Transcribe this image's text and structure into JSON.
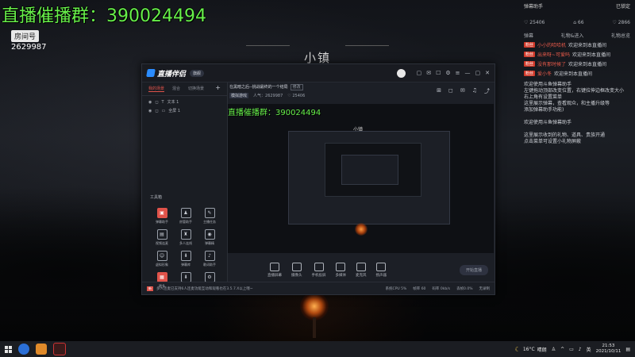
{
  "overlay": {
    "group_label": "直播催播群：",
    "group_number": "390024494",
    "room_label": "房间号",
    "room_number": "2629987"
  },
  "background": {
    "scene_title": "小镇"
  },
  "right_panel": {
    "title": "弹幕助手",
    "settings": "已锁定",
    "stats": [
      "♡ 25406",
      "⌂ 66",
      "♡ 2866"
    ],
    "tabs": [
      "弹幕",
      "礼物&进入",
      "礼物总览"
    ],
    "messages": [
      {
        "badge": "粉丝",
        "user": "小小的哈哈机",
        "text": "欢迎来到本直播间"
      },
      {
        "badge": "粉丝",
        "user": "出来呀~可爱吗",
        "text": "欢迎来到本直播间"
      },
      {
        "badge": "粉丝",
        "user": "没有那时候了",
        "text": "欢迎来到本直播间"
      },
      {
        "badge": "粉丝",
        "user": "爱小冬",
        "text": "欢迎来到本直播间"
      }
    ],
    "notes": [
      "欢迎使用斗鱼弹幕助手",
      "左键拖动顶部改变位置，右键拉伸边框改变大小",
      "右上角有设置菜单",
      "这里展示弹幕，查看观众，和主播升级等",
      "添加弹幕助手功能)",
      "",
      "欢迎使用斗鱼弹幕助手",
      "",
      "这里展示收到的礼物、道具、贵族开通",
      "点击菜单可设置小礼物屏蔽"
    ]
  },
  "app": {
    "logo_text": "直播伴侣",
    "version": "旗舰",
    "sidebar_tabs": [
      "我的场景",
      "混合",
      "切换场景"
    ],
    "scenes": [
      "文本 1",
      "全屏 1"
    ],
    "tools_label": "工具箱",
    "tools": [
      {
        "label": "弹幕助手",
        "icon": "▣",
        "red": true
      },
      {
        "label": "房管助手",
        "icon": "♟",
        "red": false
      },
      {
        "label": "主播任务",
        "icon": "✎",
        "red": false
      },
      {
        "label": "视频连麦",
        "icon": "▤",
        "red": false
      },
      {
        "label": "多人连线",
        "icon": "♜",
        "red": false
      },
      {
        "label": "弹幕精",
        "icon": "◉",
        "red": false
      },
      {
        "label": "虚拟形象",
        "icon": "☺",
        "red": false
      },
      {
        "label": "弹幕库",
        "icon": "⬇",
        "red": false
      },
      {
        "label": "歌词助手",
        "icon": "♪",
        "red": false
      },
      {
        "label": "更多",
        "icon": "▦",
        "red": false
      },
      {
        "label": "",
        "icon": "⬇",
        "red": false
      },
      {
        "label": "",
        "icon": "⚙",
        "red": false
      }
    ],
    "room_title": "在黑暗之后--挑战最终的一个结局",
    "room_tag": "修改",
    "room_sub": [
      "模拟游戏",
      "人气：2629987",
      "♡ 25406"
    ],
    "preview_group_label": "直播催播群：",
    "preview_group_number": "390024494",
    "preview_scene_title": "小镇",
    "bottom_items": [
      "直播屏幕",
      "摄像头",
      "手机投屏",
      "多媒体",
      "麦克风",
      "扬声器"
    ],
    "start_button": "开始直播",
    "status_badge": "新",
    "status_text": "多人连麦已支持6人连麦功能互动和观看也在3.5.7.X以上哦~",
    "status_right": [
      "系统CPU 5%",
      "帧率 60",
      "码率 0kb/s",
      "丢帧0.0%",
      "无录制"
    ]
  },
  "taskbar": {
    "temperature": "16°C",
    "weather": "晴朗",
    "input_method": "英",
    "time": "21:53",
    "date": "2021/10/11"
  },
  "colors": {
    "overlay_green": "#67f04a",
    "accent_red": "#e0534a",
    "brand_blue": "#2b8cff"
  }
}
